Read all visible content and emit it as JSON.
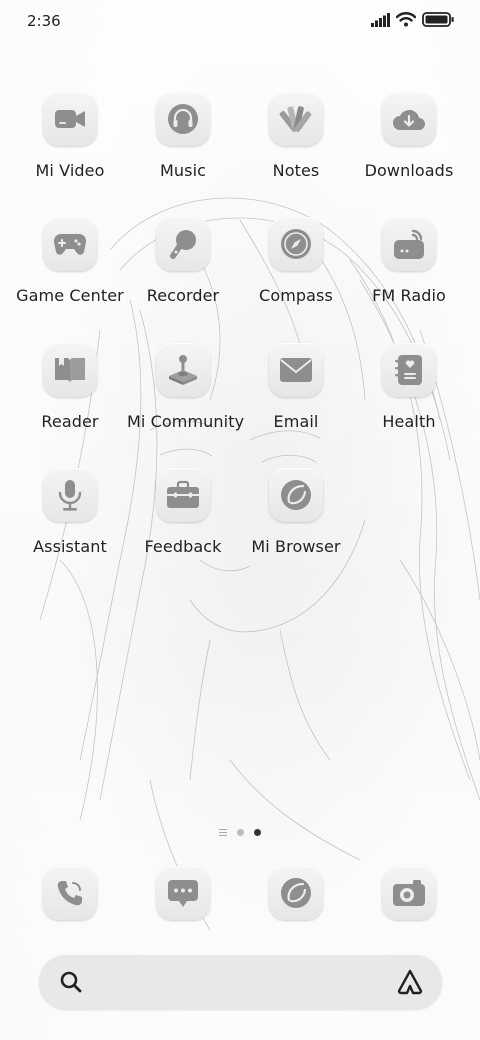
{
  "status_bar": {
    "time": "2:36",
    "icons": [
      "signal-icon",
      "wifi-icon",
      "battery-icon"
    ]
  },
  "apps": [
    {
      "label": "Mi Video",
      "icon": "video-camera-icon"
    },
    {
      "label": "Music",
      "icon": "headphones-icon"
    },
    {
      "label": "Notes",
      "icon": "notes-fan-icon"
    },
    {
      "label": "Downloads",
      "icon": "cloud-download-icon"
    },
    {
      "label": "Game Center",
      "icon": "gamepad-icon"
    },
    {
      "label": "Recorder",
      "icon": "microphone-ball-icon"
    },
    {
      "label": "Compass",
      "icon": "compass-icon"
    },
    {
      "label": "FM Radio",
      "icon": "radio-icon"
    },
    {
      "label": "Reader",
      "icon": "book-icon"
    },
    {
      "label": "Mi Community",
      "icon": "joystick-icon"
    },
    {
      "label": "Email",
      "icon": "envelope-icon"
    },
    {
      "label": "Health",
      "icon": "heart-notebook-icon"
    },
    {
      "label": "Assistant",
      "icon": "microphone-icon"
    },
    {
      "label": "Feedback",
      "icon": "toolbox-icon"
    },
    {
      "label": "Mi Browser",
      "icon": "browser-globe-icon"
    }
  ],
  "dock": [
    {
      "name": "phone",
      "icon": "phone-icon"
    },
    {
      "name": "messages",
      "icon": "message-bubble-icon"
    },
    {
      "name": "browser",
      "icon": "browser-globe-icon"
    },
    {
      "name": "camera",
      "icon": "camera-icon"
    }
  ],
  "page_indicator": {
    "pages": 2,
    "current": 2
  },
  "search": {
    "left_icon": "search-icon",
    "right_icon": "assistant-triangle-icon"
  }
}
